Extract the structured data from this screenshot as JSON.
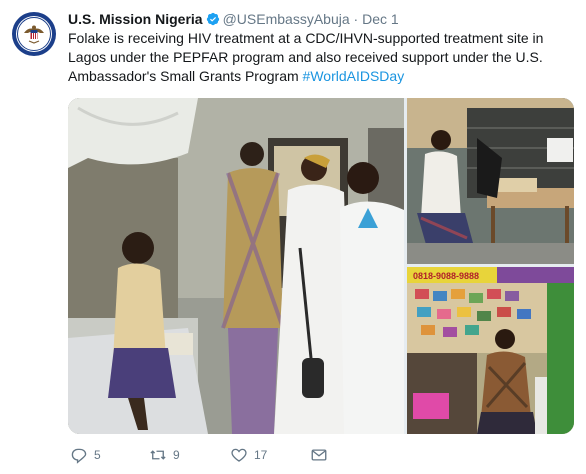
{
  "tweet": {
    "author_name": "U.S. Mission Nigeria",
    "handle": "@USEmbassyAbuja",
    "separator": "·",
    "date": "Dec 1",
    "text_main": "Folake is receiving HIV treatment at a CDC/IHVN-supported treatment site in Lagos under the PEPFAR program and also received support under the U.S. Ambassador's Small Grants Program ",
    "hashtag": "#WorldAIDSDay",
    "stats": {
      "replies": "5",
      "retweets": "9",
      "likes": "17"
    },
    "sign_text": "0818-9088-9888"
  },
  "icons": {
    "avatar": "us-seal-icon",
    "verified": "verified-badge-icon",
    "reply": "reply-icon",
    "retweet": "retweet-icon",
    "like": "heart-icon",
    "dm": "envelope-icon"
  },
  "colors": {
    "text": "#14171a",
    "secondary": "#657786",
    "link": "#1b95e0",
    "verified": "#1da1f2"
  }
}
